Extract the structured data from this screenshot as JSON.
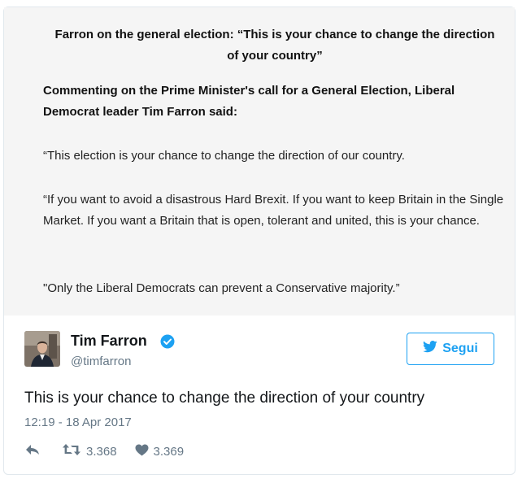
{
  "statement": {
    "title": "Farron on the general election: “This is your chance to change the direction of your country”",
    "lead": "Commenting on the Prime Minister's call for a General Election, Liberal Democrat leader Tim Farron said:",
    "paragraphs": [
      "“This election is your chance to change the direction of our country.",
      "“If you want to avoid a disastrous Hard Brexit. If you want to keep Britain in the Single Market. If you want a Britain that is open, tolerant and united, this is your chance.",
      "\"Only the Liberal Democrats can prevent a Conservative majority.”"
    ]
  },
  "tweet": {
    "author_name": "Tim Farron",
    "handle": "@timfarron",
    "follow_label": "Segui",
    "text": "This is your chance to change the direction of your country",
    "timestamp": "12:19 - 18 Apr 2017",
    "retweets": "3.368",
    "likes": "3.369"
  },
  "icons": {
    "verified": "verified-badge-icon",
    "follow": "twitter-bird-icon",
    "reply": "reply-icon",
    "retweet": "retweet-icon",
    "like": "heart-icon"
  },
  "colors": {
    "accent": "#1da1f2",
    "secondary_text": "#657786",
    "statement_bg": "#f5f5f5"
  }
}
